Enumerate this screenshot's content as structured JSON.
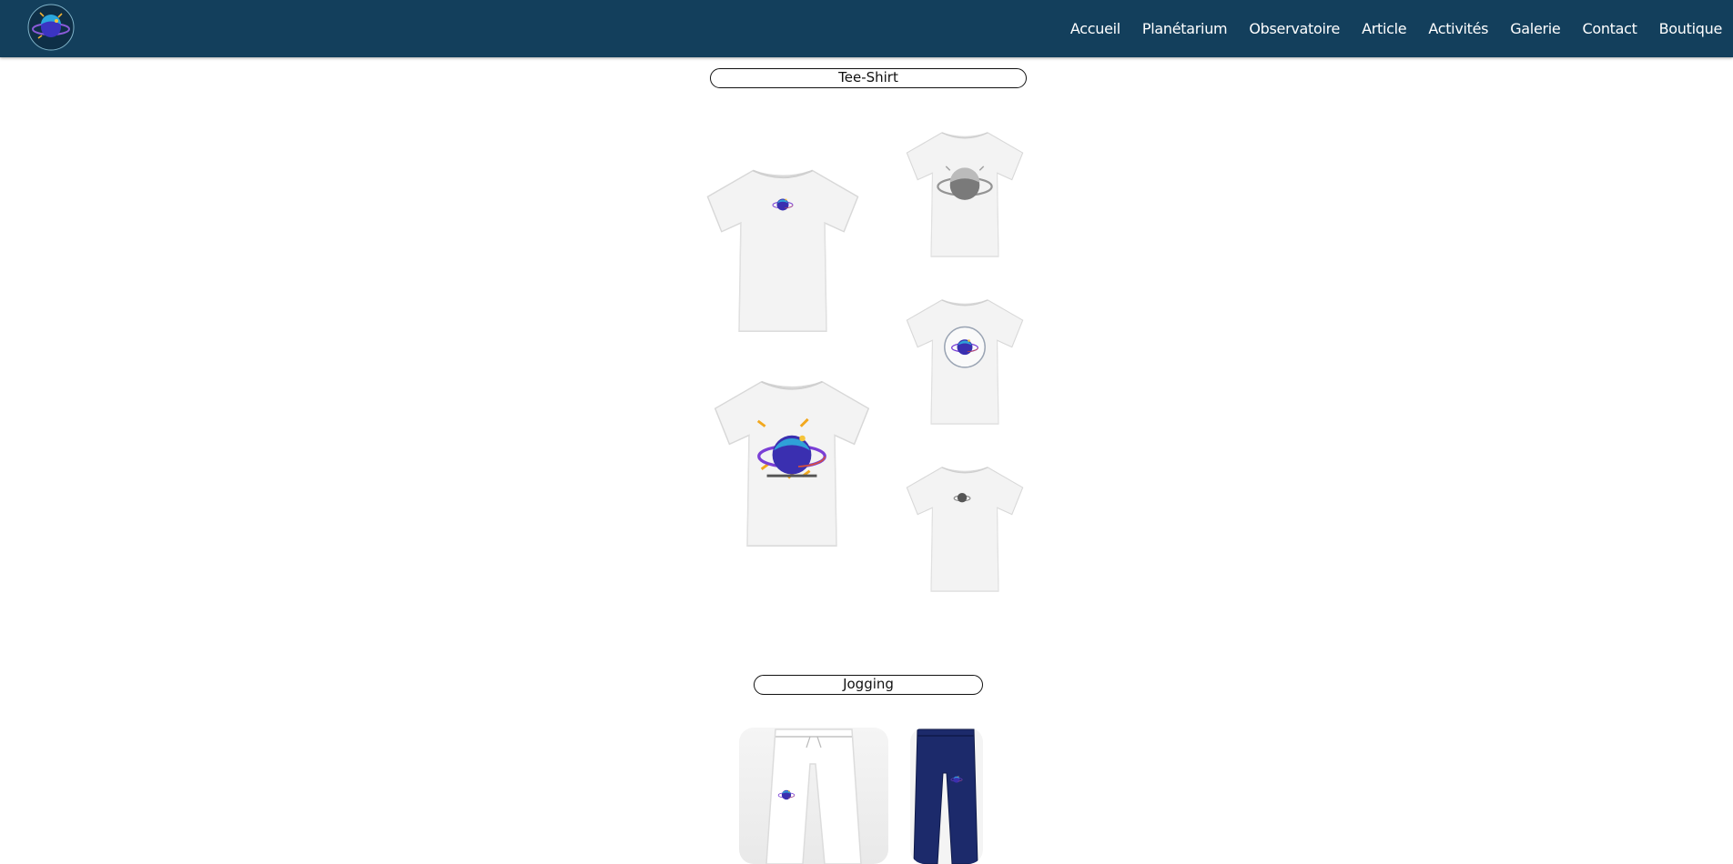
{
  "site": {
    "nav": {
      "items": [
        {
          "label": "Accueil"
        },
        {
          "label": "Planétarium"
        },
        {
          "label": "Observatoire"
        },
        {
          "label": "Article"
        },
        {
          "label": "Activités"
        },
        {
          "label": "Galerie"
        },
        {
          "label": "Contact"
        },
        {
          "label": "Boutique"
        }
      ]
    },
    "colors": {
      "navbar": "#133f5c",
      "accent": "#3a3fd0"
    }
  },
  "shop": {
    "sections": [
      {
        "title": "Tee-Shirt",
        "products": [
          {
            "icon": "tshirt-small-logo-icon"
          },
          {
            "icon": "tshirt-grey-planet-icon"
          },
          {
            "icon": "tshirt-circle-logo-icon"
          },
          {
            "icon": "tshirt-large-logo-icon"
          },
          {
            "icon": "tshirt-mini-grey-logo-icon"
          }
        ]
      },
      {
        "title": "Jogging",
        "products": [
          {
            "icon": "white-jogging-pants-icon"
          },
          {
            "icon": "navy-jogging-pants-icon"
          }
        ]
      }
    ]
  }
}
